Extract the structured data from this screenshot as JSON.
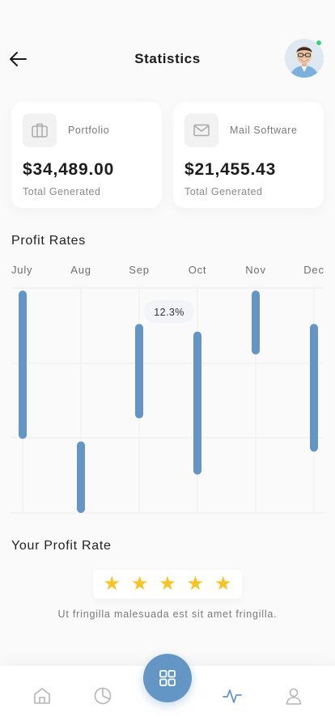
{
  "header": {
    "title": "Statistics"
  },
  "cards": [
    {
      "label": "Portfolio",
      "amount": "$34,489.00",
      "sub": "Total Generated",
      "icon": "briefcase-icon"
    },
    {
      "label": "Mail Software",
      "amount": "$21,455.43",
      "sub": "Total Generated",
      "icon": "mail-icon"
    }
  ],
  "profit_section": {
    "title": "Profit Rates"
  },
  "rate_section": {
    "title": "Your Profit Rate",
    "stars": 5,
    "caption": "Ut fringilla malesuada est sit amet fringilla."
  },
  "colors": {
    "accent": "#6396c4",
    "star": "#f6c424",
    "online": "#39d17a"
  },
  "chart_data": {
    "type": "bar",
    "categories": [
      "July",
      "Aug",
      "Sep",
      "Oct",
      "Nov",
      "Dec"
    ],
    "ranges": [
      [
        0.29,
        0.87
      ],
      [
        0.0,
        0.28
      ],
      [
        0.37,
        0.74
      ],
      [
        0.15,
        0.71
      ],
      [
        0.62,
        0.87
      ],
      [
        0.24,
        0.74
      ]
    ],
    "annotation": {
      "label": "12.3%",
      "category": "Sep"
    },
    "ylim": [
      0,
      0.88
    ],
    "grid": true
  },
  "nav": {
    "items": [
      "home-icon",
      "pie-chart-icon",
      "grid-icon",
      "activity-icon",
      "user-icon"
    ],
    "active": "activity-icon"
  }
}
